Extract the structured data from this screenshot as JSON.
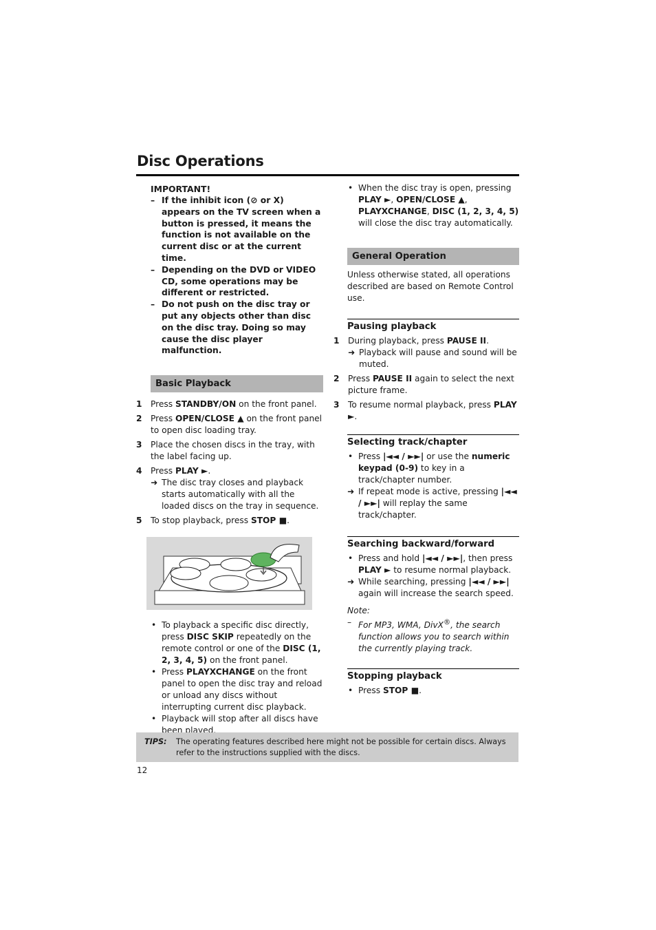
{
  "page": {
    "title": "Disc Operations",
    "page_number": "12"
  },
  "important": {
    "heading": "IMPORTANT!",
    "items": [
      {
        "pre": "If the inhibit icon (",
        "icon": "⊘",
        "mid": " or ",
        "x": "X",
        "post": ") appears on the TV screen when a button is pressed, it means the function is not available on the current disc or at the current time."
      },
      {
        "text": "Depending on the DVD or VIDEO CD, some operations may be different or restricted."
      },
      {
        "text": "Do not push on the disc tray or put any objects other than disc on the disc tray. Doing so may cause the disc player malfunction."
      }
    ]
  },
  "basic_playback": {
    "heading": "Basic Playback",
    "steps": [
      {
        "num": "1",
        "pre": "Press ",
        "bold": "STANDBY/ON",
        "post": " on the front panel."
      },
      {
        "num": "2",
        "pre": "Press ",
        "bold": "OPEN/CLOSE ▲",
        "post": " on the front panel to open disc loading tray."
      },
      {
        "num": "3",
        "text": "Place the chosen discs in the tray, with the label facing up."
      },
      {
        "num": "4",
        "pre": "Press ",
        "bold": "PLAY ►",
        "post": ".",
        "result": "The disc tray closes and playback starts automatically with all the loaded discs on the tray in sequence."
      },
      {
        "num": "5",
        "pre": "To stop playback, press ",
        "bold": "STOP ■",
        "post": "."
      }
    ],
    "figure_alt": "Disc tray with five disc slots, hand placing a disc",
    "bullets": [
      {
        "p1": "To playback a specific disc directly, press ",
        "b1": "DISC SKIP",
        "p2": " repeatedly on the remote control or one of the ",
        "b2": "DISC (1, 2, 3, 4, 5)",
        "p3": " on the front panel."
      },
      {
        "p1": "Press ",
        "b1": "PLAYXCHANGE",
        "p2": " on the front panel to open the disc tray and reload or unload any discs without interrupting current disc playback."
      },
      {
        "p1": "Playback will stop after all discs have been played."
      }
    ]
  },
  "right_intro": {
    "b1": "PLAY ►",
    "s1": ", ",
    "b2": "OPEN/CLOSE ▲",
    "s2": ", ",
    "b3": "PLAYXCHANGE",
    "s3": ", ",
    "b4": "DISC (1, 2, 3, 4, 5)",
    "pre": "When the disc tray is open, pressing ",
    "post": " will close the disc tray automatically."
  },
  "general_operation": {
    "heading": "General Operation",
    "text": "Unless otherwise stated, all operations described are based on Remote Control use."
  },
  "pausing": {
    "heading": "Pausing playback",
    "steps": [
      {
        "num": "1",
        "pre": "During playback, press ",
        "bold": "PAUSE II",
        "post": ".",
        "result": "Playback will pause and sound will be muted."
      },
      {
        "num": "2",
        "pre": "Press ",
        "bold": "PAUSE II",
        "post": " again to select the next picture frame."
      },
      {
        "num": "3",
        "pre": "To resume normal playback, press ",
        "bold": "PLAY ►",
        "post": "."
      }
    ]
  },
  "selecting": {
    "heading": "Selecting track/chapter",
    "bullet": {
      "pre": "Press ",
      "sym": "|◄◄ / ►►|",
      "mid": " or use the ",
      "bold": "numeric keypad (0-9)",
      "post": " to key in a track/chapter number."
    },
    "result": {
      "pre": "If repeat mode is active, pressing ",
      "sym": "|◄◄ / ►►|",
      "post": " will replay the same track/chapter."
    }
  },
  "searching": {
    "heading": "Searching backward/forward",
    "bullet": {
      "pre": "Press and hold ",
      "sym": "|◄◄ / ►►|",
      "mid": ", then press ",
      "bold": "PLAY ►",
      "post": " to resume normal playback."
    },
    "result": {
      "pre": "While searching, pressing ",
      "sym": "|◄◄ / ►►|",
      "post": " again will increase the search speed."
    },
    "note_label": "Note:",
    "note_pre": "For MP3, WMA, DivX",
    "note_reg": "®",
    "note_post": ", the search function allows you to search within the currently playing track."
  },
  "stopping": {
    "heading": "Stopping playback",
    "bullet": {
      "pre": "Press ",
      "bold": "STOP ■",
      "post": "."
    }
  },
  "tips": {
    "label": "TIPS:",
    "text": "The operating features described here might not be possible for certain discs. Always refer to the instructions supplied with the discs."
  },
  "glyphs": {
    "dash": "–",
    "bullet": "•",
    "arrow": "➜"
  }
}
